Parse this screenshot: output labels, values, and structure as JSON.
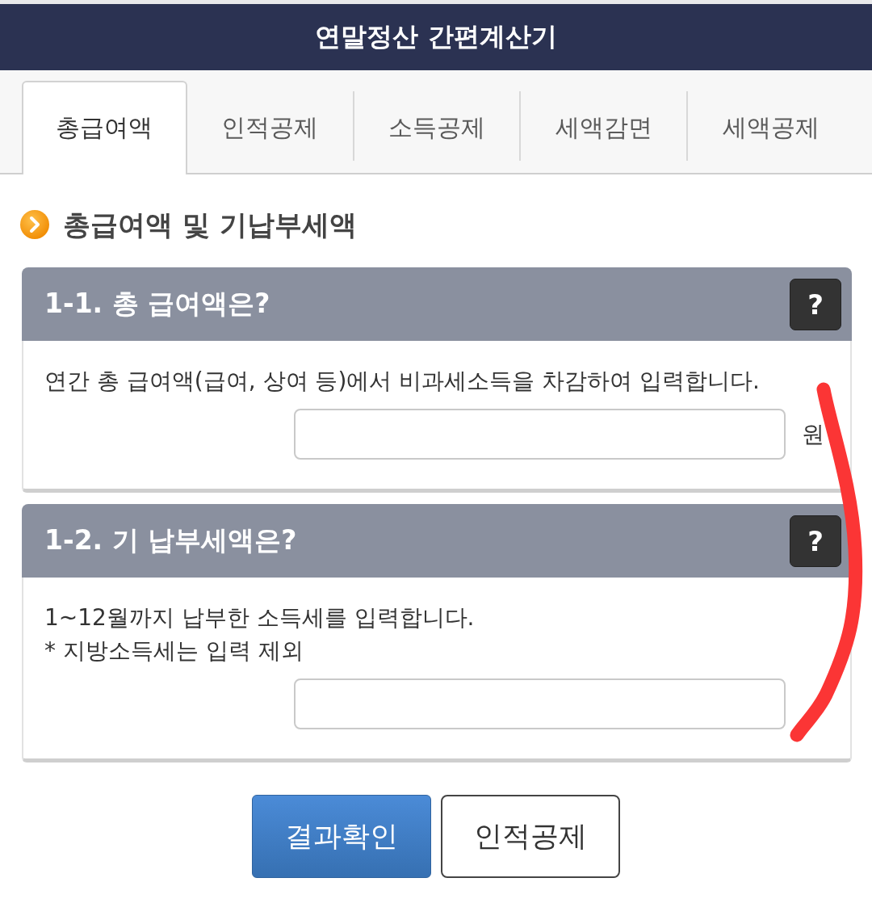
{
  "header": {
    "title": "연말정산 간편계산기"
  },
  "tabs": [
    {
      "label": "총급여액",
      "selected": true
    },
    {
      "label": "인적공제",
      "selected": false
    },
    {
      "label": "소득공제",
      "selected": false
    },
    {
      "label": "세액감면",
      "selected": false
    },
    {
      "label": "세액공제",
      "selected": false
    }
  ],
  "section": {
    "title": "총급여액 및 기납부세액"
  },
  "questions": [
    {
      "title": "1-1. 총 급여액은?",
      "help": "?",
      "description": [
        "연간 총 급여액(급여, 상여 등)에서 비과세소득을 차감하여 입력합니다."
      ],
      "unit": "원"
    },
    {
      "title": "1-2. 기 납부세액은?",
      "help": "?",
      "description": [
        "1~12월까지 납부한 소득세를 입력합니다.",
        "* 지방소득세는 입력 제외"
      ]
    }
  ],
  "buttons": [
    {
      "label": "결과확인",
      "kind": "primary"
    },
    {
      "label": "인적공제",
      "kind": "secondary"
    }
  ],
  "annotation": {
    "kind": "stroke"
  }
}
